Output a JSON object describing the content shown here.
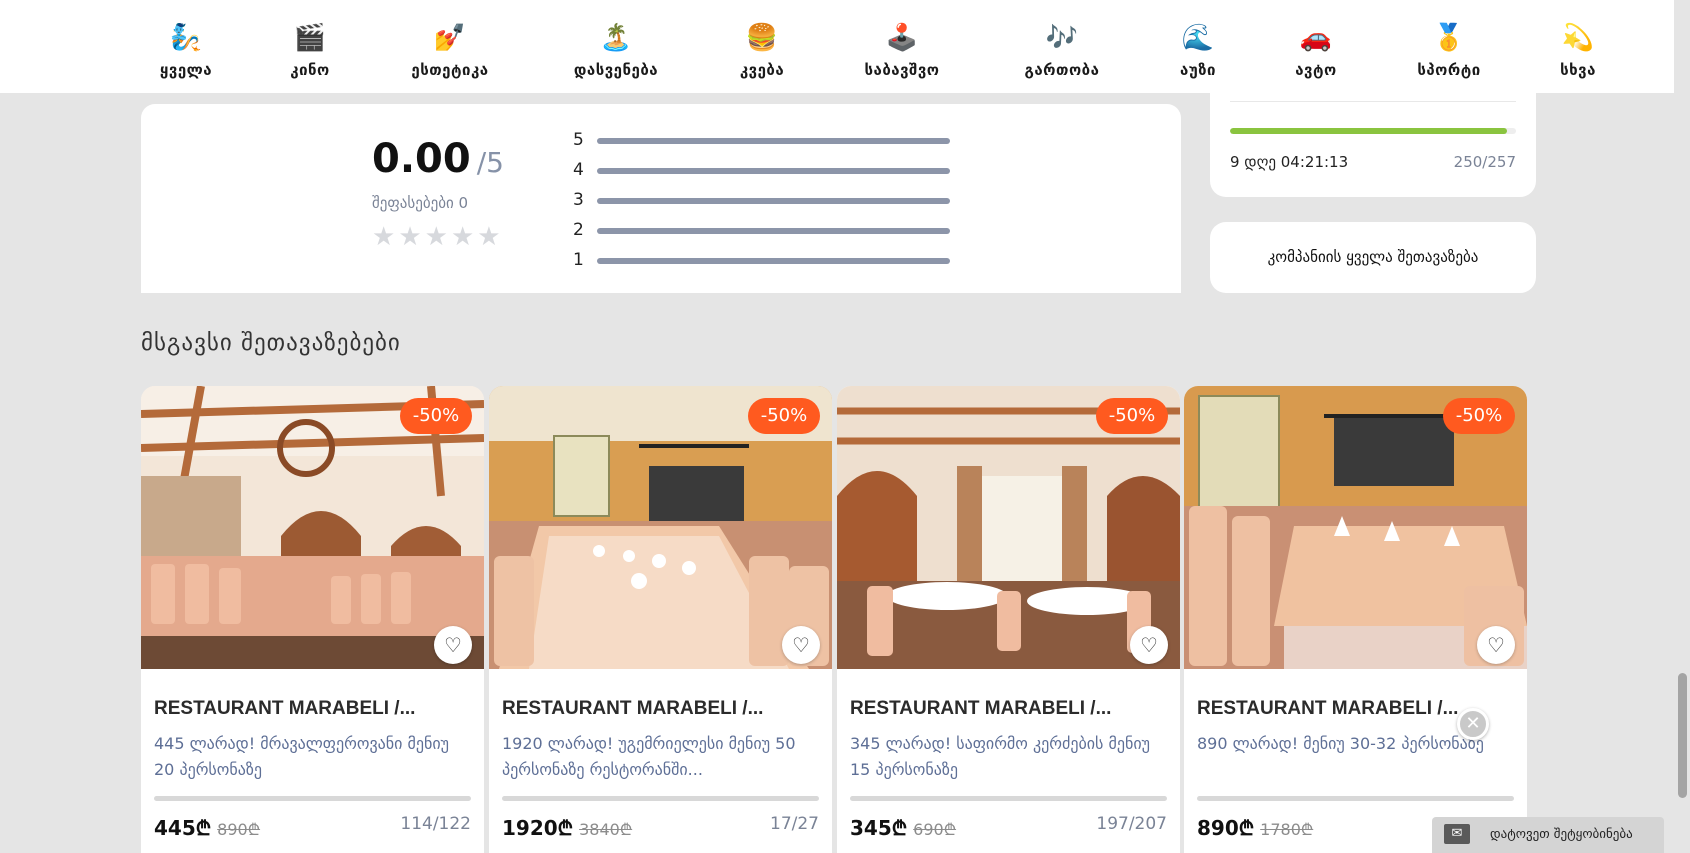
{
  "categories": [
    {
      "icon": "🧞",
      "icon_name": "genie-icon",
      "label": "ყველა"
    },
    {
      "icon": "🎬",
      "icon_name": "clapper-icon",
      "label": "კინო"
    },
    {
      "icon": "💅",
      "icon_name": "nail-polish-icon",
      "label": "ესთეტიკა"
    },
    {
      "icon": "🏝️",
      "icon_name": "island-icon",
      "label": "დასვენება"
    },
    {
      "icon": "🍔",
      "icon_name": "burger-icon",
      "label": "კვება"
    },
    {
      "icon": "🕹️",
      "icon_name": "joystick-icon",
      "label": "საბავშვო"
    },
    {
      "icon": "🎶",
      "icon_name": "music-notes-icon",
      "label": "გართობა"
    },
    {
      "icon": "🌊",
      "icon_name": "wave-icon",
      "label": "აუზი"
    },
    {
      "icon": "🚗",
      "icon_name": "car-icon",
      "label": "ავტო"
    },
    {
      "icon": "🥇",
      "icon_name": "medal-icon",
      "label": "სპორტი"
    },
    {
      "icon": "💫",
      "icon_name": "dizzy-star-icon",
      "label": "სხვა"
    }
  ],
  "rating": {
    "score": "0.00",
    "max": "/5",
    "count_label": "შეფასებები 0",
    "star_icon": "★",
    "star_count": 5,
    "levels": [
      "5",
      "4",
      "3",
      "2",
      "1"
    ]
  },
  "deal_timer": {
    "progress_fraction": 0.97,
    "remaining": "9 დღე 04:21:13",
    "sold": "250/257",
    "progress_color": "#8ac43f"
  },
  "all_offers_label": "კომპანიის ყველა შეთავაზება",
  "similar": {
    "title": "მსგავსი შეთავაზებები",
    "cards": [
      {
        "discount": "-50%",
        "name": "RESTAURANT MARABELI /...",
        "description": "445 ლარად! მრავალფეროვანი მენიუ 20 პერსონაზე",
        "price": "445₾",
        "old_price": "890₾",
        "sold": "114/122"
      },
      {
        "discount": "-50%",
        "name": "RESTAURANT MARABELI /...",
        "description": "1920 ლარად! უგემრიელესი მენიუ 50 პერსონაზე რესტორანში...",
        "price": "1920₾",
        "old_price": "3840₾",
        "sold": "17/27"
      },
      {
        "discount": "-50%",
        "name": "RESTAURANT MARABELI /...",
        "description": "345 ლარად! საფირმო კერძების მენიუ 15 პერსონაზე",
        "price": "345₾",
        "old_price": "690₾",
        "sold": "197/207"
      },
      {
        "discount": "-50%",
        "name": "RESTAURANT MARABELI /...",
        "description": "890 ლარად! მენიუ 30-32 პერსონაზე",
        "price": "890₾",
        "old_price": "1780₾",
        "sold": ""
      }
    ],
    "favorite_icon": "♡"
  },
  "close_icon": "✕",
  "message_bar": {
    "icon": "✉",
    "label": "დატოვეთ შეტყობინება"
  },
  "colors": {
    "discount_badge": "#ff5a1f",
    "description_text": "#5e6f96",
    "rating_bar": "#8c95a9",
    "page_background": "#e5e5e5"
  }
}
